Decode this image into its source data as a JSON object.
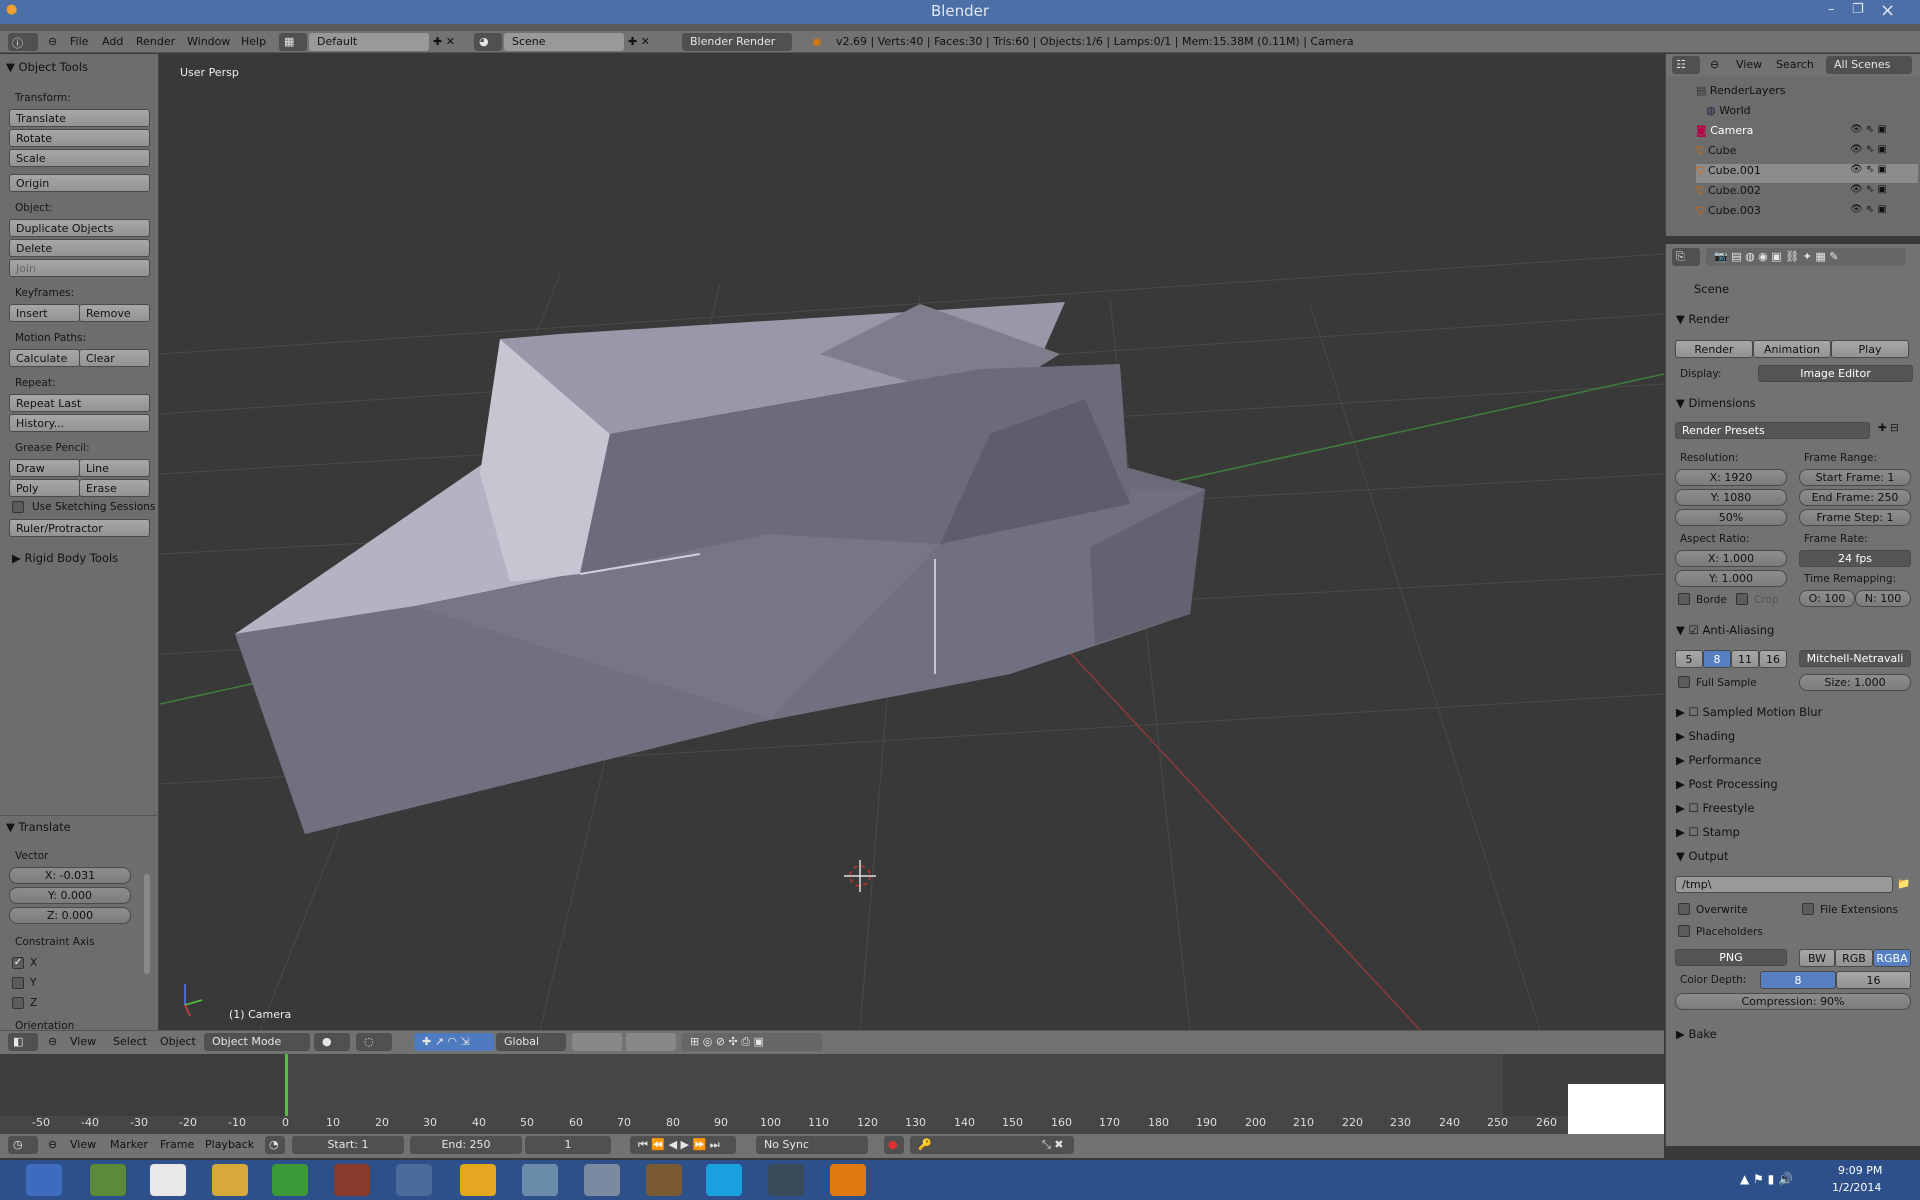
{
  "window": {
    "title": "Blender"
  },
  "infobar": {
    "menus": [
      "File",
      "Add",
      "Render",
      "Window",
      "Help"
    ],
    "layout": "Default",
    "scene": "Scene",
    "engine": "Blender Render",
    "stats": "v2.69 | Verts:40 | Faces:30 | Tris:60 | Objects:1/6 | Lamps:0/1 | Mem:15.38M (0.11M) | Camera"
  },
  "toolshelf": {
    "title": "Object Tools",
    "transform_label": "Transform:",
    "translate": "Translate",
    "rotate": "Rotate",
    "scale": "Scale",
    "origin": "Origin",
    "object_label": "Object:",
    "duplicate": "Duplicate Objects",
    "delete": "Delete",
    "join": "Join",
    "keyframes_label": "Keyframes:",
    "insert": "Insert",
    "remove": "Remove",
    "motion_label": "Motion Paths:",
    "calculate": "Calculate",
    "clear": "Clear",
    "repeat_label": "Repeat:",
    "repeat_last": "Repeat Last",
    "history": "History...",
    "grease_label": "Grease Pencil:",
    "draw": "Draw",
    "line": "Line",
    "poly": "Poly",
    "erase": "Erase",
    "sketch": "Use Sketching Sessions",
    "ruler": "Ruler/Protractor",
    "rigid": "Rigid Body Tools"
  },
  "operator": {
    "title": "Translate",
    "vector_label": "Vector",
    "x": "X: -0.031",
    "y": "Y: 0.000",
    "z": "Z: 0.000",
    "constraint_label": "Constraint Axis",
    "cx": "X",
    "cy": "Y",
    "cz": "Z",
    "orientation": "Orientation"
  },
  "viewport": {
    "persp": "User Persp",
    "object": "(1) Camera"
  },
  "vphdr": {
    "view": "View",
    "select": "Select",
    "object": "Object",
    "mode": "Object Mode",
    "orient": "Global"
  },
  "timeline": {
    "ticks": [
      "-50",
      "-40",
      "-30",
      "-20",
      "-10",
      "0",
      "10",
      "20",
      "30",
      "40",
      "50",
      "60",
      "70",
      "80",
      "90",
      "100",
      "110",
      "120",
      "130",
      "140",
      "150",
      "160",
      "170",
      "180",
      "190",
      "200",
      "210",
      "220",
      "230",
      "240",
      "250",
      "260"
    ],
    "view": "View",
    "marker": "Marker",
    "frame": "Frame",
    "playback": "Playback",
    "start": "Start: 1",
    "end": "End: 250",
    "current": "1",
    "sync": "No Sync"
  },
  "outliner": {
    "view": "View",
    "search": "Search",
    "scenes": "All Scenes",
    "items": [
      "RenderLayers",
      "World",
      "Camera",
      "Cube",
      "Cube.001",
      "Cube.002",
      "Cube.003"
    ]
  },
  "props": {
    "scene": "Scene",
    "render": "Render",
    "render_btn": "Render",
    "animation_btn": "Animation",
    "play_btn": "Play",
    "display_label": "Display:",
    "display": "Image Editor",
    "dimensions": "Dimensions",
    "presets": "Render Presets",
    "res_label": "Resolution:",
    "resx": "X: 1920",
    "resy": "Y: 1080",
    "pct": "50%",
    "fr_label": "Frame Range:",
    "fstart": "Start Frame: 1",
    "fend": "End Frame: 250",
    "fstep": "Frame Step: 1",
    "asp_label": "Aspect Ratio:",
    "ax": "X: 1.000",
    "ay": "Y: 1.000",
    "rate_label": "Frame Rate:",
    "rate": "24 fps",
    "remap_label": "Time Remapping:",
    "old": "O: 100",
    "new": "N: 100",
    "border": "Borde",
    "crop": "Crop",
    "aa": "Anti-Aliasing",
    "aa5": "5",
    "aa8": "8",
    "aa11": "11",
    "aa16": "16",
    "filter": "Mitchell-Netravali",
    "full": "Full Sample",
    "size": "Size: 1.000",
    "motion": "Sampled Motion Blur",
    "shading": "Shading",
    "performance": "Performance",
    "post": "Post Processing",
    "freestyle": "Freestyle",
    "stamp": "Stamp",
    "output": "Output",
    "path": "/tmp\\",
    "overwrite": "Overwrite",
    "ext": "File Extensions",
    "placeholders": "Placeholders",
    "format": "PNG",
    "bw": "BW",
    "rgb": "RGB",
    "rgba": "RGBA",
    "depth_label": "Color Depth:",
    "d8": "8",
    "d16": "16",
    "compression": "Compression: 90%",
    "bake": "Bake"
  },
  "taskbar": {
    "time": "9:09 PM",
    "date": "1/2/2014"
  }
}
